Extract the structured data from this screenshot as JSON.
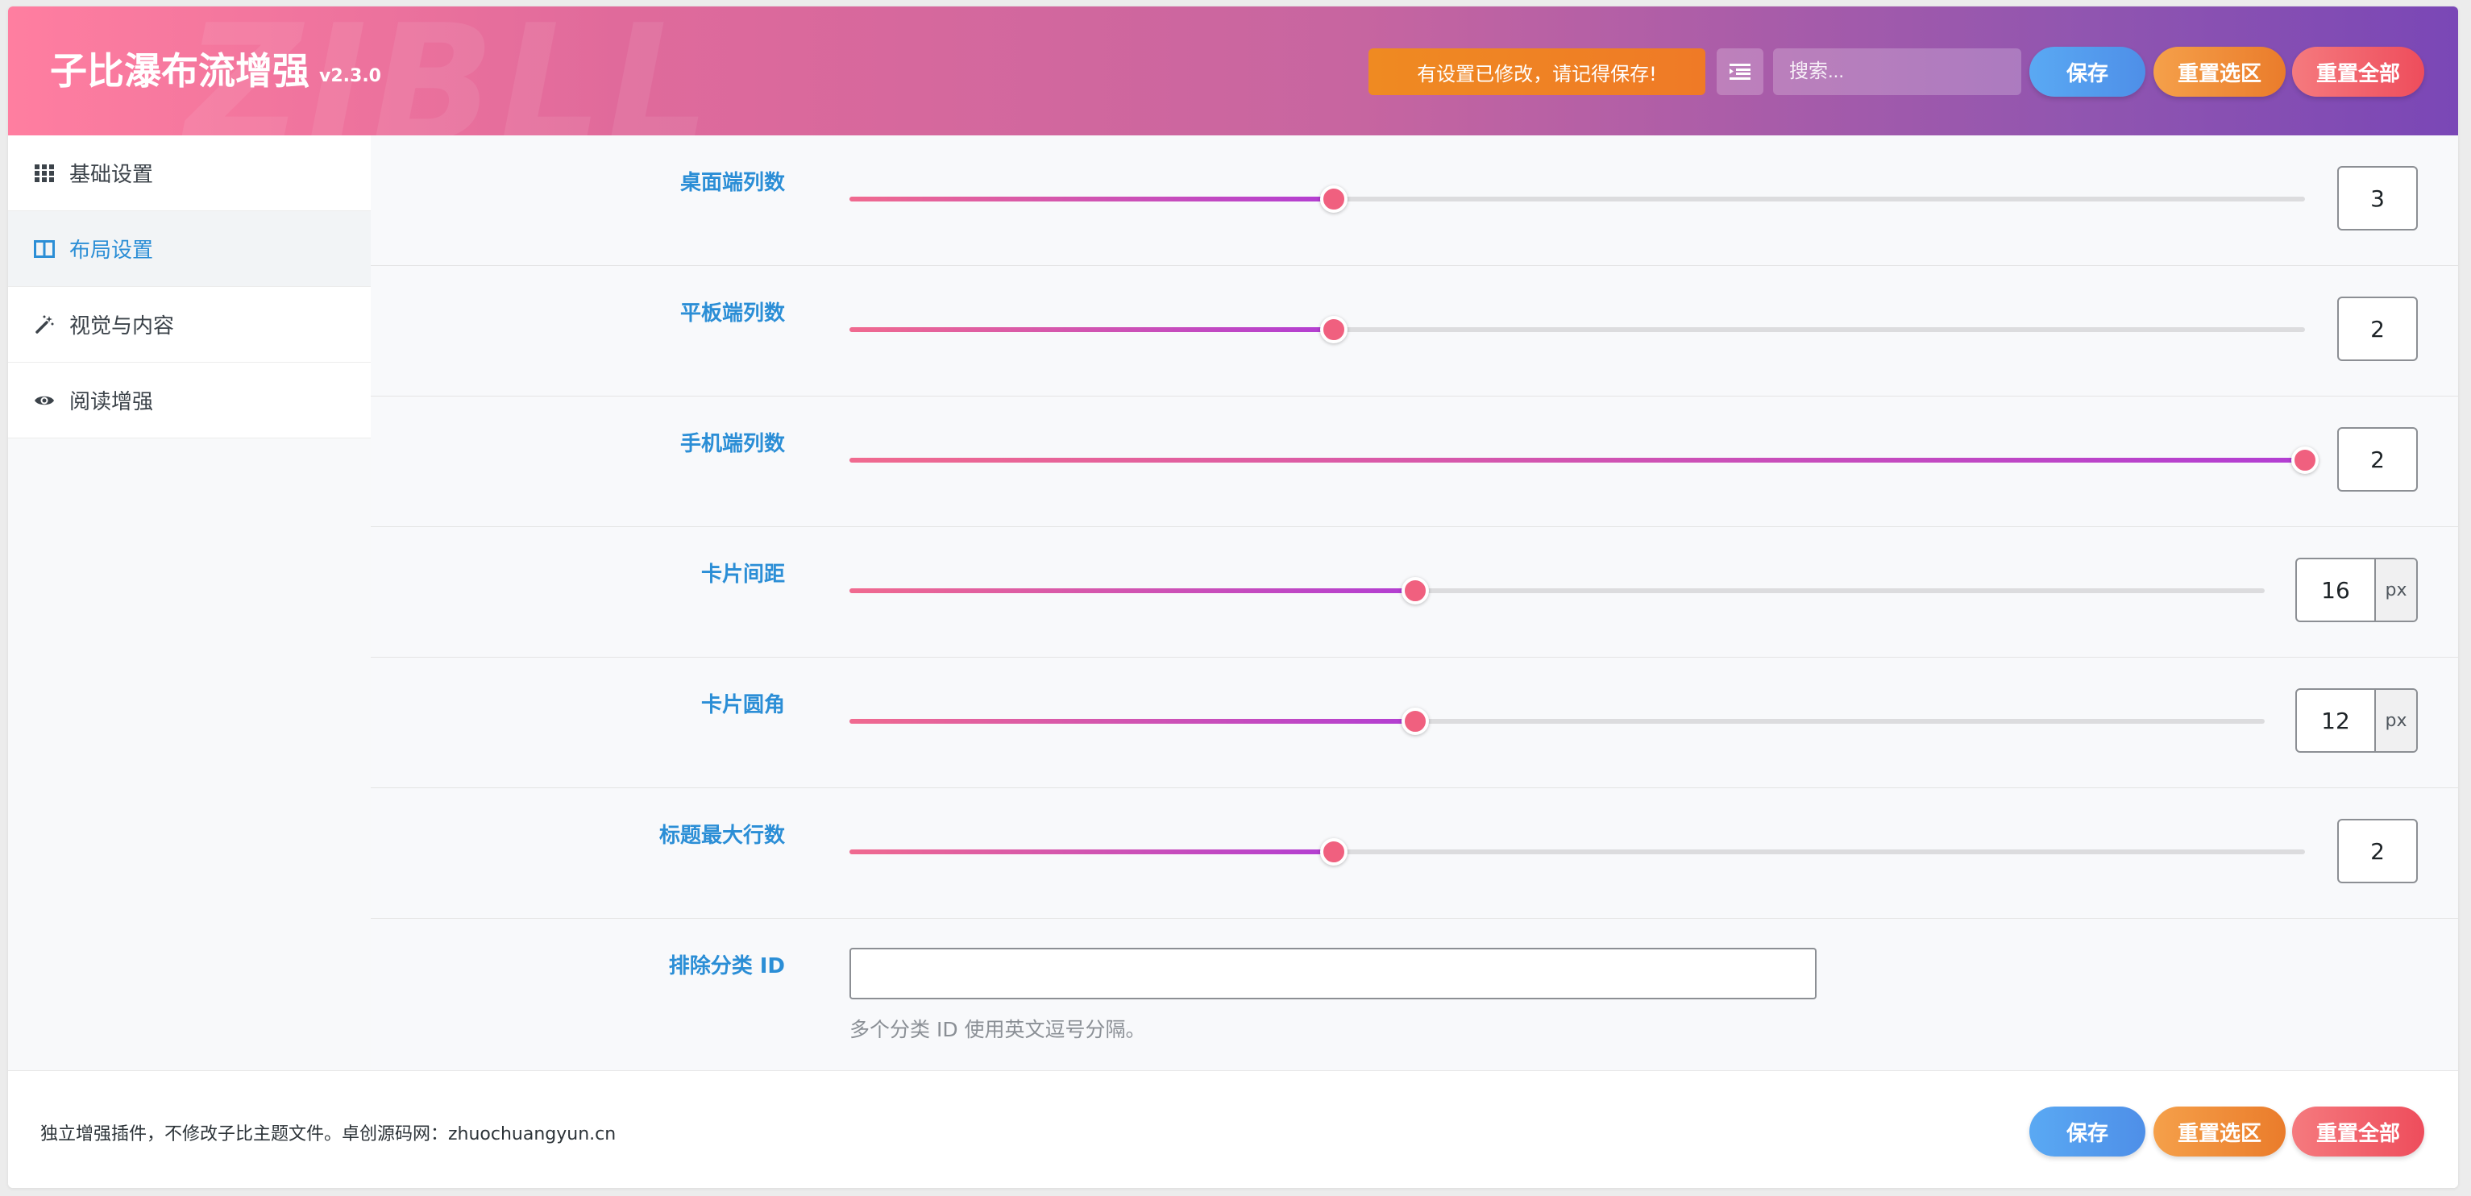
{
  "header": {
    "watermark": "ZIBLL",
    "title": "子比瀑布流增强",
    "version": "v2.3.0",
    "notice": "有设置已修改，请记得保存!",
    "search_placeholder": "搜索...",
    "save_label": "保存",
    "reset_section_label": "重置选区",
    "reset_all_label": "重置全部"
  },
  "sidebar": {
    "items": [
      {
        "label": "基础设置",
        "icon": "grid-icon",
        "active": false
      },
      {
        "label": "布局设置",
        "icon": "columns-icon",
        "active": true
      },
      {
        "label": "视觉与内容",
        "icon": "magic-wand-icon",
        "active": false
      },
      {
        "label": "阅读增强",
        "icon": "eye-icon",
        "active": false
      }
    ]
  },
  "fields": {
    "desktop_columns": {
      "label": "桌面端列数",
      "value": "3",
      "fraction": 0.333
    },
    "tablet_columns": {
      "label": "平板端列数",
      "value": "2",
      "fraction": 0.333
    },
    "mobile_columns": {
      "label": "手机端列数",
      "value": "2",
      "fraction": 1.0
    },
    "card_gap": {
      "label": "卡片间距",
      "value": "16",
      "unit": "px",
      "fraction": 0.4
    },
    "card_radius": {
      "label": "卡片圆角",
      "value": "12",
      "unit": "px",
      "fraction": 0.4
    },
    "title_max_lines": {
      "label": "标题最大行数",
      "value": "2",
      "fraction": 0.333
    },
    "exclude_category": {
      "label": "排除分类 ID",
      "value": "",
      "help": "多个分类 ID 使用英文逗号分隔。"
    }
  },
  "footer": {
    "text": "独立增强插件，不修改子比主题文件。卓创源码网：zhuochuangyun.cn",
    "save_label": "保存",
    "reset_section_label": "重置选区",
    "reset_all_label": "重置全部"
  },
  "colors": {
    "accent": "#2b8ed6",
    "header_start": "#ff7ea0",
    "header_end": "#7a47b6",
    "slider_start": "#f06a8f",
    "slider_end": "#b23ed3",
    "notice": "#ef8a22"
  }
}
